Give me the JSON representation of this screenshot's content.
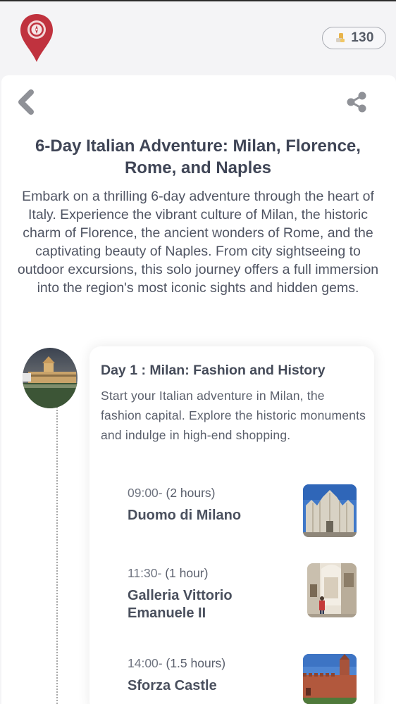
{
  "header": {
    "coin_count": "130",
    "logo_icon": "map-pin-icon",
    "coin_icon": "coins-icon",
    "brand_color": "#c0323e"
  },
  "nav": {
    "back_icon": "chevron-left-icon",
    "share_icon": "share-icon"
  },
  "trip": {
    "title": "6-Day Italian Adventure: Milan, Florence, Rome, and Naples",
    "description": "Embark on a thrilling 6-day adventure through the heart of Italy. Experience the vibrant culture of Milan, the historic charm of Florence, the ancient wonders of Rome, and the captivating beauty of Naples. From city sightseeing to outdoor excursions, this solo journey offers a full immersion into the region's most iconic sights and hidden gems."
  },
  "days": [
    {
      "title": "Day 1 : Milan: Fashion and History",
      "description": "Start your Italian adventure in Milan, the fashion capital. Explore the historic monuments and indulge in high-end shopping.",
      "activities": [
        {
          "time": "09:00-",
          "duration": " (2 hours)",
          "name": "Duomo di Milano"
        },
        {
          "time": "11:30-",
          "duration": " (1 hour)",
          "name": "Galleria Vittorio Emanuele II"
        },
        {
          "time": "14:00-",
          "duration": " (1.5 hours)",
          "name": "Sforza Castle"
        }
      ]
    }
  ]
}
